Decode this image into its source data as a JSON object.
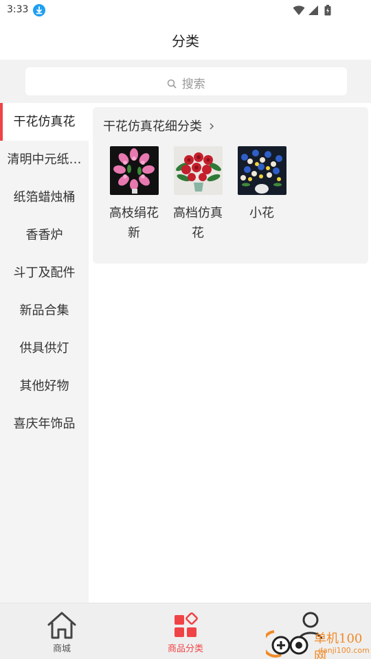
{
  "status_bar": {
    "time": "3:33",
    "icons": [
      "download-icon",
      "wifi-icon",
      "signal-icon",
      "battery-icon"
    ]
  },
  "header": {
    "title": "分类"
  },
  "search": {
    "placeholder": "搜索",
    "icon": "search-icon"
  },
  "sidebar": {
    "items": [
      {
        "label": "干花仿真花",
        "active": true
      },
      {
        "label": "清明中元纸…",
        "active": false
      },
      {
        "label": "纸箔蜡烛桶",
        "active": false
      },
      {
        "label": "香香炉",
        "active": false
      },
      {
        "label": "斗丁及配件",
        "active": false
      },
      {
        "label": "新品合集",
        "active": false
      },
      {
        "label": "供具供灯",
        "active": false
      },
      {
        "label": "其他好物",
        "active": false
      },
      {
        "label": "喜庆年饰品",
        "active": false
      }
    ]
  },
  "category": {
    "title": "干花仿真花细分类",
    "products": [
      {
        "name": "高枝绢花新"
      },
      {
        "name": "高档仿真花"
      },
      {
        "name": "小花"
      }
    ]
  },
  "tabbar": {
    "tabs": [
      {
        "label": "商城",
        "icon": "home-icon",
        "active": false
      },
      {
        "label": "商品分类",
        "icon": "category-icon",
        "active": true
      },
      {
        "label": "",
        "icon": "user-icon",
        "active": false
      }
    ]
  },
  "watermark": {
    "text": "单机100网",
    "sub": "danji100.com"
  },
  "colors": {
    "accent": "#f04346",
    "background": "#f4f4f4"
  }
}
